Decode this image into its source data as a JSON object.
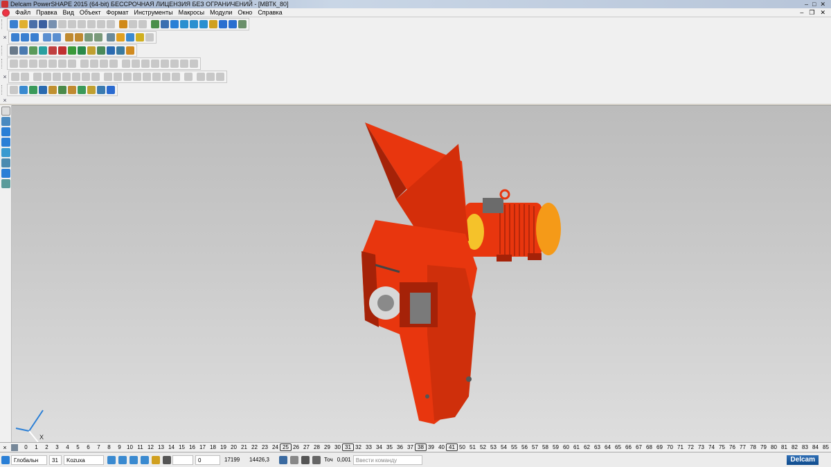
{
  "window": {
    "title": "Delcam PowerSHAPE 2015 (64-bit) БЕССРОЧНАЯ ЛИЦЕНЗИЯ БЕЗ ОГРАНИЧЕНИЙ - [МВТК_80]",
    "controls": [
      "–",
      "□",
      "✕"
    ]
  },
  "menu": {
    "items": [
      "Файл",
      "Правка",
      "Вид",
      "Объект",
      "Формат",
      "Инструменты",
      "Макросы",
      "Модули",
      "Окно",
      "Справка"
    ],
    "mdi_controls": [
      "–",
      "❐",
      "✕"
    ]
  },
  "levels": {
    "items": [
      "0",
      "1",
      "2",
      "3",
      "4",
      "5",
      "6",
      "7",
      "8",
      "9",
      "10",
      "11",
      "12",
      "13",
      "14",
      "15",
      "16",
      "17",
      "18",
      "19",
      "20",
      "21",
      "22",
      "23",
      "24",
      "25",
      "26",
      "27",
      "28",
      "29",
      "30",
      "31",
      "32",
      "33",
      "34",
      "35",
      "36",
      "37",
      "38",
      "39",
      "40",
      "41",
      "50",
      "51",
      "52",
      "53",
      "54",
      "55",
      "56",
      "57",
      "58",
      "59",
      "60",
      "61",
      "62",
      "63",
      "64",
      "65",
      "66",
      "67",
      "68",
      "69",
      "70",
      "71",
      "72",
      "73",
      "74",
      "75",
      "76",
      "77",
      "78",
      "79",
      "80",
      "81",
      "82",
      "83",
      "84",
      "85"
    ],
    "active": [
      "25",
      "31",
      "38",
      "41"
    ]
  },
  "status": {
    "workplane": "Глобальн",
    "level_number": "31",
    "level_name": "Kozuxa",
    "field_value": "0",
    "coord_a": "17199",
    "coord_b": "14426,3",
    "tolerance_label": "Точ",
    "tolerance_value": "0,001",
    "command_placeholder": "Ввести команду",
    "brand": "Delcam"
  },
  "triad": {
    "x_label": "X"
  },
  "colors": {
    "model_body": "#e8360e",
    "model_shadow": "#a52208",
    "motor_cap": "#f59a18",
    "viewport_top": "#bcbcbc",
    "viewport_bottom": "#dedede",
    "triad_axis": "#2a7fd6"
  },
  "icons": [
    "file-new-icon",
    "file-open-icon",
    "save-icon",
    "print-icon",
    "undo-icon",
    "redo-icon",
    "select-icon",
    "shade-icon",
    "solid-icon",
    "surface-icon",
    "level-icon",
    "cut-icon",
    "copy-icon",
    "paste-icon",
    "delete-icon",
    "zoom-icon",
    "rotate-icon",
    "sketch-icon",
    "pointer-icon",
    "workplane-icon"
  ]
}
